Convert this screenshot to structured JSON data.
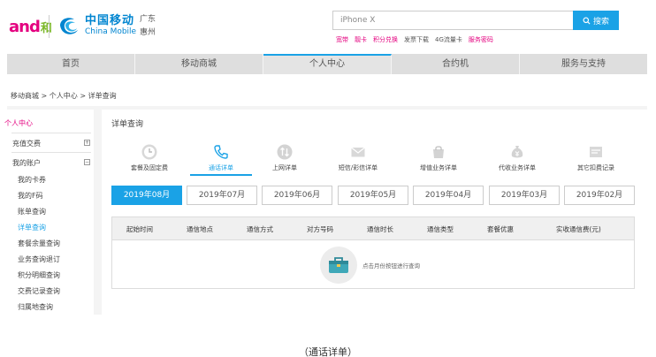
{
  "header": {
    "logo_and": "and",
    "logo_he": "和",
    "brand_cn": "中国移动",
    "brand_en": "China Mobile",
    "region_line1": "广东",
    "region_line2": "惠州"
  },
  "search": {
    "value": "iPhone X",
    "button_label": "搜索",
    "hot_words": [
      {
        "label": "宽带",
        "highlight": true
      },
      {
        "label": "靓卡",
        "highlight": true
      },
      {
        "label": "积分兑换",
        "highlight": true
      },
      {
        "label": "发票下载",
        "highlight": false
      },
      {
        "label": "4G流量卡",
        "highlight": false
      },
      {
        "label": "服务密码",
        "highlight": true
      }
    ]
  },
  "nav": {
    "items": [
      "首页",
      "移动商城",
      "个人中心",
      "合约机",
      "服务与支持"
    ],
    "active_index": 2
  },
  "breadcrumb": "移动商城 >  个人中心 > 详单查询",
  "sidebar": {
    "title": "个人中心",
    "section_recharge": "充值交费",
    "section_account": "我的账户",
    "items": [
      "我的卡券",
      "我的F码",
      "账单查询",
      "详单查询",
      "套餐余量查询",
      "业务查询退订",
      "积分明细查询",
      "交费记录查询",
      "归属地查询"
    ],
    "active_item_index": 3,
    "toggle_plus": "+",
    "toggle_minus": "−"
  },
  "panel": {
    "title": "详单查询",
    "categories": [
      {
        "label": "套餐及固定费",
        "icon": "clock-icon"
      },
      {
        "label": "通话详单",
        "icon": "phone-icon"
      },
      {
        "label": "上网详单",
        "icon": "data-icon"
      },
      {
        "label": "短信/彩信详单",
        "icon": "mail-icon"
      },
      {
        "label": "增值业务详单",
        "icon": "bag-icon"
      },
      {
        "label": "代收业务详单",
        "icon": "money-bag-icon"
      },
      {
        "label": "其它扣费记录",
        "icon": "ticket-icon"
      }
    ],
    "active_category_index": 1,
    "months": [
      "2019年08月",
      "2019年07月",
      "2019年06月",
      "2019年05月",
      "2019年04月",
      "2019年03月",
      "2019年02月"
    ],
    "active_month_index": 0,
    "table_columns": [
      "起始时间",
      "通信地点",
      "通信方式",
      "对方号码",
      "通信时长",
      "通信类型",
      "套餐优惠",
      "实收通信费(元)"
    ],
    "empty_message": "点击月份按钮进行查询"
  },
  "caption": "（通话详单）",
  "colors": {
    "accent": "#1aa2e6",
    "brand_pink": "#e4007f",
    "brand_blue": "#0085d0"
  }
}
